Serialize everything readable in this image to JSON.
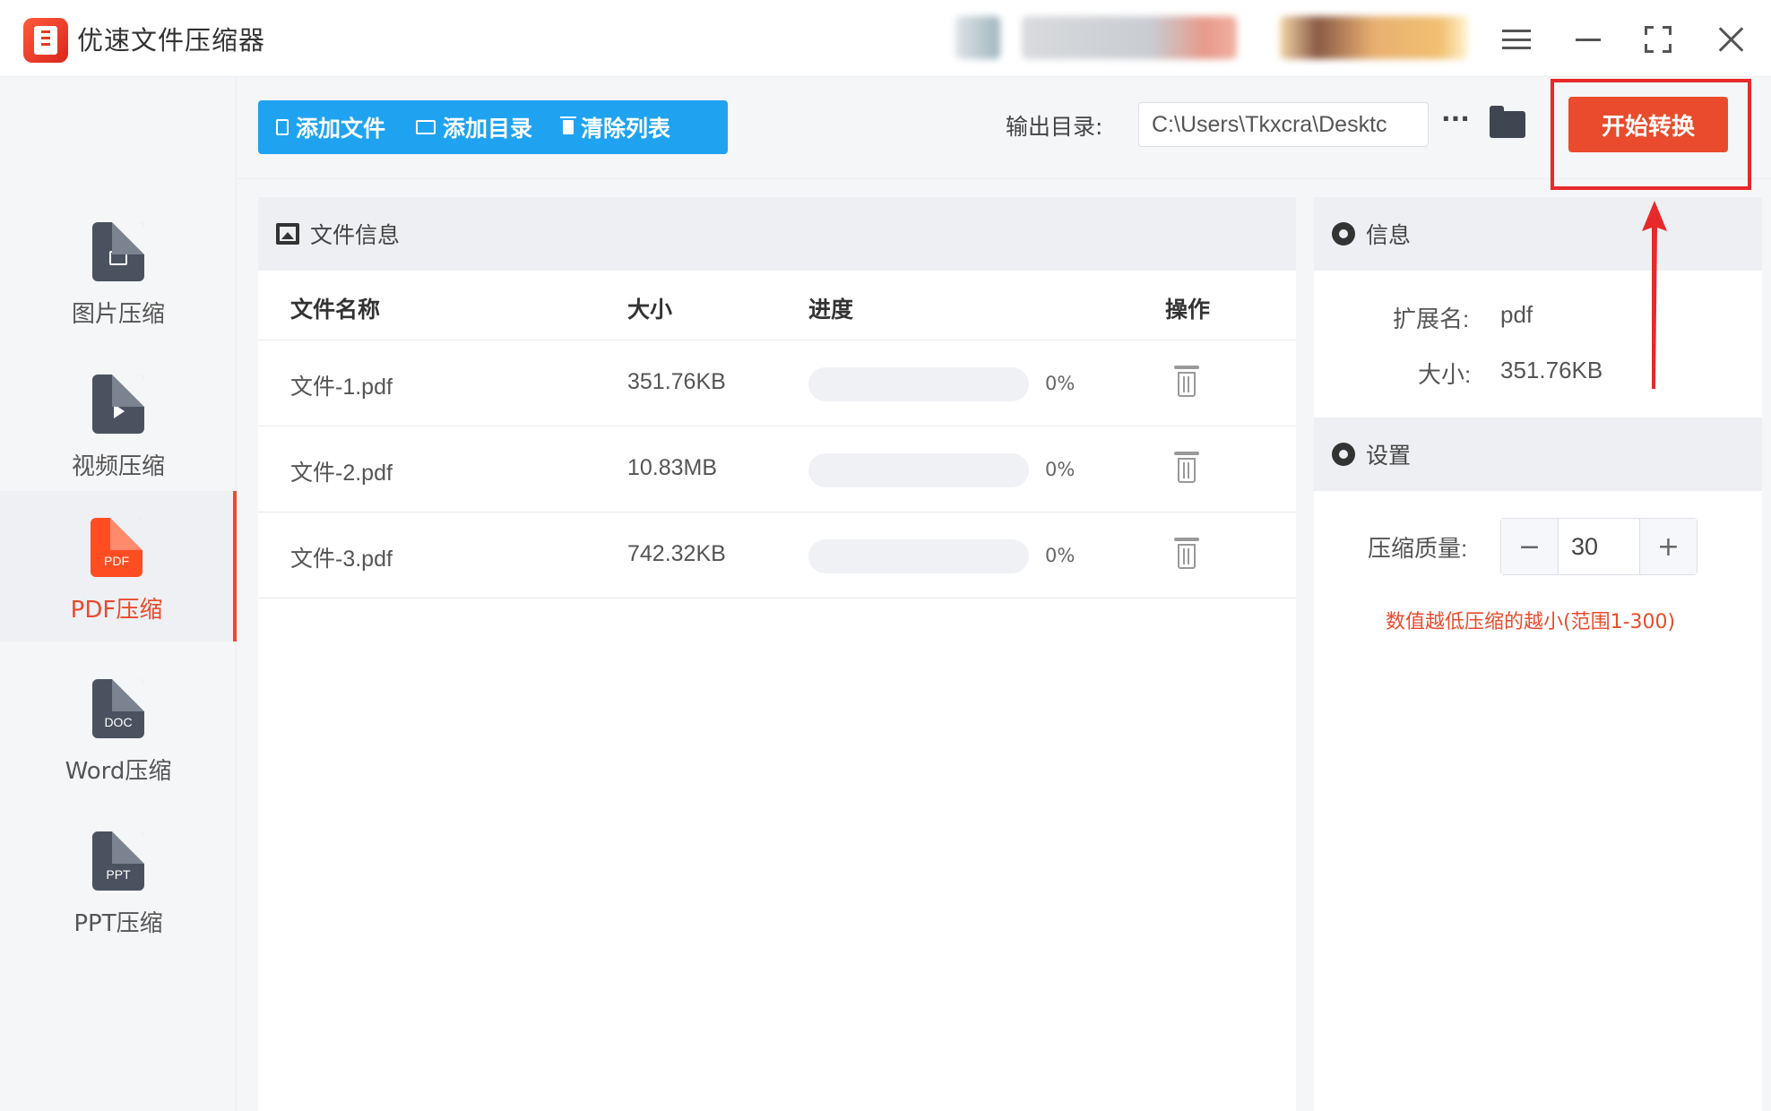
{
  "window": {
    "title": "优速文件压缩器"
  },
  "sidebar": {
    "items": [
      {
        "label": "图片压缩",
        "icon": "image-file-icon"
      },
      {
        "label": "视频压缩",
        "icon": "video-file-icon"
      },
      {
        "label": "PDF压缩",
        "icon": "pdf-file-icon",
        "badge": "PDF",
        "active": true
      },
      {
        "label": "Word压缩",
        "icon": "doc-file-icon",
        "badge": "DOC"
      },
      {
        "label": "PPT压缩",
        "icon": "ppt-file-icon",
        "badge": "PPT"
      }
    ]
  },
  "toolbar": {
    "add_file": "添加文件",
    "add_folder": "添加目录",
    "clear_list": "清除列表",
    "output_label": "输出目录:",
    "output_path": "C:\\Users\\Tkxcra\\Desktc",
    "more": "···",
    "start_button": "开始转换",
    "accent_color": "#1fa3f0",
    "start_color": "#e94b2c"
  },
  "file_panel": {
    "title": "文件信息",
    "columns": [
      "文件名称",
      "大小",
      "进度",
      "操作"
    ],
    "rows": [
      {
        "name": "文件-1.pdf",
        "size": "351.76KB",
        "progress": 0,
        "progress_text": "0%"
      },
      {
        "name": "文件-2.pdf",
        "size": "10.83MB",
        "progress": 0,
        "progress_text": "0%"
      },
      {
        "name": "文件-3.pdf",
        "size": "742.32KB",
        "progress": 0,
        "progress_text": "0%"
      }
    ]
  },
  "info_panel": {
    "title": "信息",
    "ext_label": "扩展名:",
    "ext_value": "pdf",
    "size_label": "大小:",
    "size_value": "351.76KB"
  },
  "settings_panel": {
    "title": "设置",
    "quality_label": "压缩质量:",
    "quality_value": "30",
    "minus": "−",
    "plus": "+",
    "hint": "数值越低压缩的越小(范围1-300)"
  }
}
